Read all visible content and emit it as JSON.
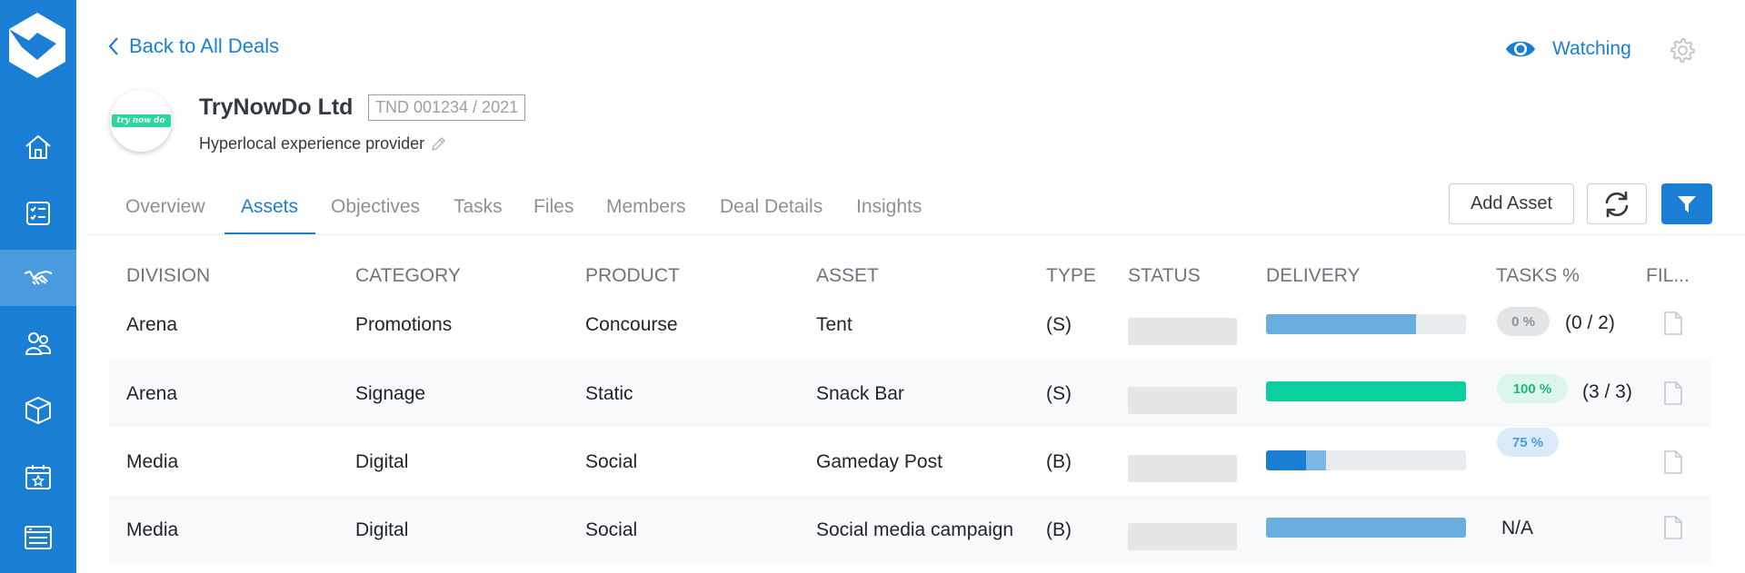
{
  "header": {
    "back_label": "Back to All Deals",
    "watching_label": "Watching"
  },
  "company": {
    "logo_text": "try now do",
    "name": "TryNowDo Ltd",
    "code": "TND 001234 / 2021",
    "subtitle": "Hyperlocal experience provider"
  },
  "tabs": [
    {
      "label": "Overview"
    },
    {
      "label": "Assets"
    },
    {
      "label": "Objectives"
    },
    {
      "label": "Tasks"
    },
    {
      "label": "Files"
    },
    {
      "label": "Members"
    },
    {
      "label": "Deal Details"
    },
    {
      "label": "Insights"
    }
  ],
  "active_tab": "Assets",
  "toolbar": {
    "add_asset_label": "Add Asset"
  },
  "table": {
    "columns": [
      "DIVISION",
      "CATEGORY",
      "PRODUCT",
      "ASSET",
      "TYPE",
      "STATUS",
      "DELIVERY",
      "TASKS %",
      "FIL..."
    ],
    "rows": [
      {
        "division": "Arena",
        "category": "Promotions",
        "product": "Concourse",
        "asset": "Tent",
        "type": "(S)",
        "delivery": [
          {
            "fraction": 0.75,
            "color": "#6aaee0"
          }
        ],
        "tasks_pct": "0 %",
        "tasks_count": "(0 / 2)"
      },
      {
        "division": "Arena",
        "category": "Signage",
        "product": "Static",
        "asset": "Snack Bar",
        "type": "(S)",
        "delivery": [
          {
            "fraction": 1.0,
            "color": "#0ccf9f"
          }
        ],
        "tasks_pct": "100 %",
        "tasks_count": "(3 / 3)"
      },
      {
        "division": "Media",
        "category": "Digital",
        "product": "Social",
        "asset": "Gameday Post",
        "type": "(B)",
        "delivery": [
          {
            "fraction": 0.2,
            "color": "#1a7fd4"
          },
          {
            "fraction": 0.1,
            "color": "#7db7e6"
          }
        ],
        "tasks_pct": "75 %",
        "tasks_count": ""
      },
      {
        "division": "Media",
        "category": "Digital",
        "product": "Social",
        "asset": "Social media campaign",
        "type": "(B)",
        "delivery": [
          {
            "fraction": 1.0,
            "color": "#6aaee0"
          }
        ],
        "tasks_pct": "N/A",
        "tasks_count": ""
      }
    ]
  },
  "colors": {
    "brand": "#1a7fd4",
    "sidebar_active": "#4a9be0",
    "badge_gray_bg": "#e2e4e6",
    "badge_green_bg": "#dcf6ec",
    "badge_green_text": "#1fb57e",
    "badge_blue_bg": "#dbeaf8",
    "badge_blue_text": "#4d9be0"
  },
  "icons": {
    "sidebar": [
      "home-icon",
      "checklist-icon",
      "handshake-icon",
      "group-icon",
      "package-icon",
      "calendar-star-icon",
      "list-window-icon"
    ],
    "watching": "eye-icon",
    "settings": "gear-icon",
    "refresh": "refresh-icon",
    "filter": "filter-icon",
    "file": "file-icon",
    "edit": "pencil-icon"
  }
}
